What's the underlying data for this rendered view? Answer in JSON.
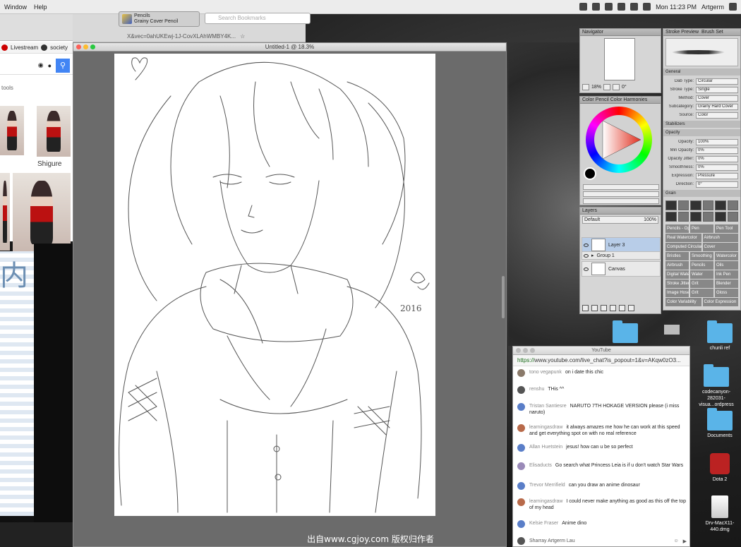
{
  "menubar": {
    "items": [
      "Window",
      "Help"
    ],
    "clock": "Mon 11:23 PM",
    "user": "Artgerm"
  },
  "browser": {
    "bookmarks": [
      "Livestream",
      "society"
    ],
    "tools": "tools",
    "result_label": "Shigure",
    "url": "X&vec=0ahUKEwj-1J-CovXLAhWMBY4K...",
    "tab_label_1": "Pencils",
    "tab_label_2": "Grainy Cover Pencil",
    "search_placeholder": "Search Bookmarks",
    "sidebar_kanji": "内"
  },
  "sai": {
    "title": "Untitled-1 @ 18.3%",
    "navigator_title": "Navigator",
    "zoom": "18%",
    "angle": "0°",
    "color_tabs": [
      "Color",
      "Pencil",
      "Color Harmonies"
    ],
    "layers_title": "Layers",
    "blend_mode": "Default",
    "opacity": "100%",
    "layers": [
      {
        "name": "Layer 3",
        "selected": true
      },
      {
        "name": "Group 1",
        "selected": false
      },
      {
        "name": "Canvas",
        "selected": false
      }
    ],
    "tool_tabs": [
      "Stroke Preview",
      "Brush Set"
    ],
    "props": [
      {
        "k": "Dab Type:",
        "v": "Circular"
      },
      {
        "k": "Stroke Type:",
        "v": "Single"
      },
      {
        "k": "Method:",
        "v": "Cover"
      },
      {
        "k": "Subcategory:",
        "v": "Grainy Hard Cover"
      },
      {
        "k": "Source:",
        "v": "Color"
      }
    ],
    "sections": [
      "General",
      "Stabilizers",
      "Opacity",
      "Smoothing",
      "Grain",
      "Expression"
    ],
    "sliders": [
      {
        "k": "Opacity:",
        "v": "100%"
      },
      {
        "k": "Min Opacity:",
        "v": "0%"
      },
      {
        "k": "Opacity Jitter:",
        "v": "0%"
      },
      {
        "k": "Smoothness:",
        "v": "0%"
      },
      {
        "k": "Expression:",
        "v": "Pressure"
      },
      {
        "k": "Direction:",
        "v": "0°"
      }
    ],
    "brush_list": [
      [
        "Pencils - Opaque",
        "Pen",
        "Pen Tool"
      ],
      [
        "Real Watercolor",
        "Airbrush"
      ],
      [
        "Computed Circular",
        "Cover"
      ],
      [
        "Bristles",
        "Smoothing",
        "Watercolor"
      ],
      [
        "Airbrush",
        "Pencils",
        "Oils"
      ],
      [
        "Digital Watercolor",
        "Water",
        "Ink Pen"
      ],
      [
        "Stroke Jitter",
        "Grit",
        "Blender"
      ],
      [
        "Image Hose",
        "Grit",
        "Gloss"
      ],
      [
        "Color Variability",
        "Color Expression"
      ]
    ]
  },
  "chat": {
    "window_title": "YouTube",
    "url_secure": "https://",
    "url_rest": "www.youtube.com/live_chat?is_popout=1&v=AKqw0zO3...",
    "messages": [
      {
        "user": "tono vegapunk",
        "text": "on i date this chic",
        "avatar_color": "#8a7a6a"
      },
      {
        "user": "renshu",
        "text": "THis ^^",
        "avatar_color": "#555"
      },
      {
        "user": "Tristan Santiesre",
        "text": "NARUTO 7TH HOKAGE VERSION please (i miss naruto)",
        "avatar_color": "#5a7ec8"
      },
      {
        "user": "learningasdraw",
        "text": "it always amazes me how he can work at this speed and get everything spot on with no real reference",
        "avatar_color": "#b86a4a"
      },
      {
        "user": "Allan Huetstein",
        "text": "jesus! how can u be so perfect",
        "avatar_color": "#5a7ec8"
      },
      {
        "user": "Elisaducts",
        "text": "Go search what Princess Leia is if u don't watch Star Wars",
        "avatar_color": "#9a8ab8"
      },
      {
        "user": "Trevor Merrifield",
        "text": "can you draw an anime dinosaur",
        "avatar_color": "#5a7ec8"
      },
      {
        "user": "learningasdraw",
        "text": "I could never make anything as good as this off the top of my head",
        "avatar_color": "#b86a4a"
      },
      {
        "user": "Kelsie Fraser",
        "text": "Anime dino",
        "avatar_color": "#5a7ec8"
      }
    ],
    "current_user": "Sharray Artgerm Lau"
  },
  "desktop_icons": [
    {
      "label": "",
      "type": "folder"
    },
    {
      "label": "",
      "type": "image"
    },
    {
      "label": "chunli ref",
      "type": "folder"
    },
    {
      "label": "codecanyon-282031-visua...ordpress",
      "type": "folder"
    },
    {
      "label": "Documents",
      "type": "folder"
    },
    {
      "label": "Dota 2",
      "type": "dota"
    },
    {
      "label": "Drv-MacX11-440.dmg",
      "type": "dmg"
    }
  ],
  "signature": {
    "text": "2016"
  },
  "watermark": "出自www.cgjoy.com 版权归作者"
}
